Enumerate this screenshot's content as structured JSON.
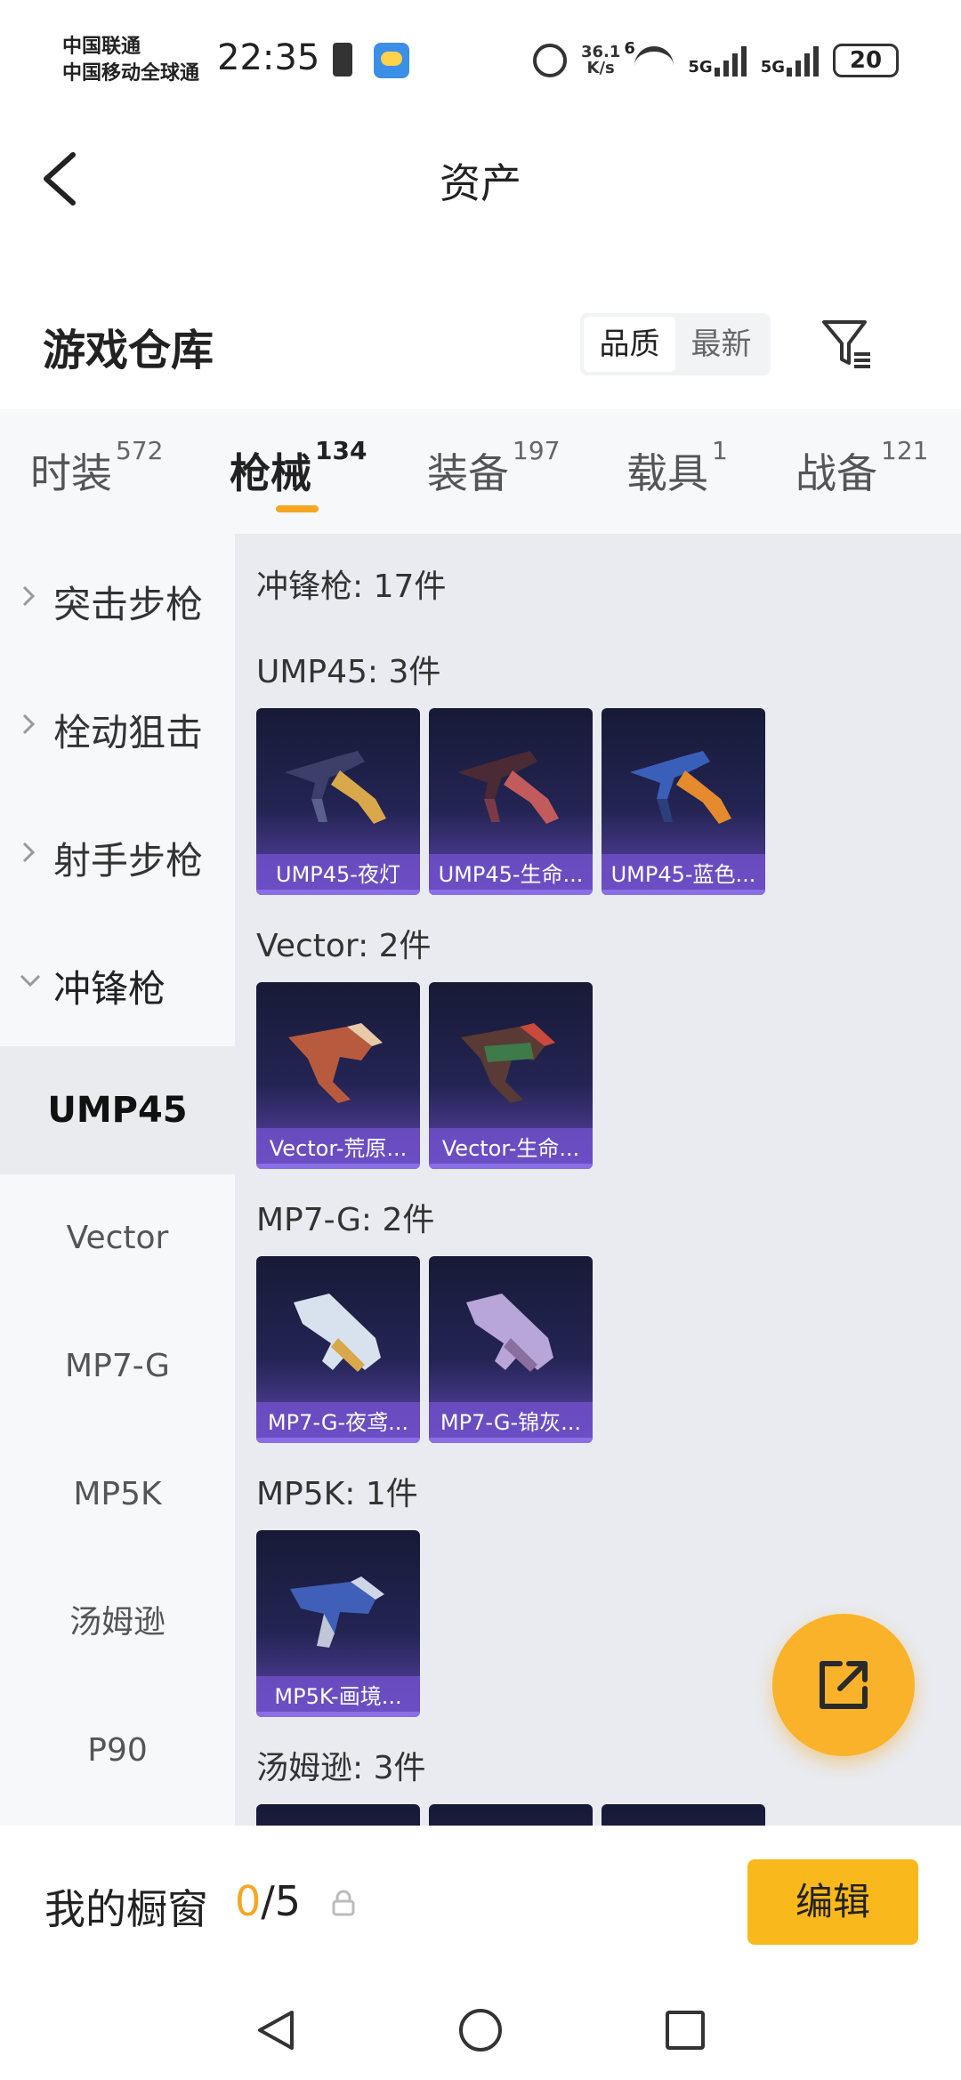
{
  "status_bar": {
    "carrier_1": "中国联通",
    "carrier_2": "中国移动全球通",
    "time": "22:35",
    "speed": "36.1",
    "speed_unit": "K/s",
    "wifi_badge": "6",
    "sim1": "5G",
    "sim2": "5G",
    "battery": "20"
  },
  "header": {
    "title": "资产"
  },
  "warehouse": {
    "title": "游戏仓库",
    "sort_options": [
      "品质",
      "最新"
    ]
  },
  "category_tabs": [
    {
      "label": "时装",
      "count": "572"
    },
    {
      "label": "枪械",
      "count": "134"
    },
    {
      "label": "装备",
      "count": "197"
    },
    {
      "label": "载具",
      "count": "1"
    },
    {
      "label": "战备",
      "count": "121"
    }
  ],
  "sidebar": {
    "groups": [
      {
        "label": "突击步枪"
      },
      {
        "label": "栓动狙击"
      },
      {
        "label": "射手步枪"
      },
      {
        "label": "冲锋枪"
      }
    ],
    "subitems": [
      {
        "label": "UMP45"
      },
      {
        "label": "Vector"
      },
      {
        "label": "MP7-G"
      },
      {
        "label": "MP5K"
      },
      {
        "label": "汤姆逊"
      },
      {
        "label": "P90"
      }
    ]
  },
  "content": {
    "category_title": "冲锋枪: 17件",
    "sections": [
      {
        "title": "UMP45: 3件",
        "items": [
          "UMP45-夜灯",
          "UMP45-生命...",
          "UMP45-蓝色..."
        ]
      },
      {
        "title": "Vector: 2件",
        "items": [
          "Vector-荒原...",
          "Vector-生命..."
        ]
      },
      {
        "title": "MP7-G: 2件",
        "items": [
          "MP7-G-夜鸢...",
          "MP7-G-锦灰..."
        ]
      },
      {
        "title": "MP5K: 1件",
        "items": [
          "MP5K-画境..."
        ]
      },
      {
        "title": "汤姆逊: 3件",
        "items": [
          "",
          "",
          ""
        ]
      }
    ]
  },
  "bottom_bar": {
    "showcase_label": "我的橱窗",
    "showcase_current": "0",
    "showcase_total": "/5",
    "edit_label": "编辑"
  },
  "colors": {
    "accent": "#f9b81c",
    "card_bg": "#242454",
    "card_caption": "#6e50c8"
  }
}
